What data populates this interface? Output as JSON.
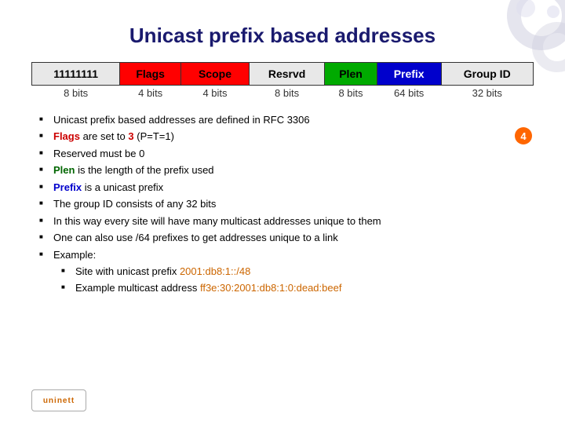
{
  "title": "Unicast prefix based addresses",
  "table": {
    "headers": [
      "11111111",
      "Flags",
      "Scope",
      "Resrvd",
      "Plen",
      "Prefix",
      "Group ID"
    ],
    "bits": [
      "8 bits",
      "4 bits",
      "4 bits",
      "8 bits",
      "8 bits",
      "64 bits",
      "32 bits"
    ]
  },
  "bullets": [
    {
      "text": "Unicast prefix based addresses are defined in RFC 3306",
      "highlights": []
    },
    {
      "text": "Flags are set to 3 (P=T=1)",
      "highlights": [
        {
          "word": "Flags",
          "color": "red"
        },
        {
          "word": "3",
          "color": "red"
        }
      ]
    },
    {
      "text": "Reserved must be 0",
      "highlights": []
    },
    {
      "text": "Plen is the length of the prefix used",
      "highlights": [
        {
          "word": "Plen",
          "color": "green"
        }
      ]
    },
    {
      "text": "Prefix is a unicast prefix",
      "highlights": [
        {
          "word": "Prefix",
          "color": "blue"
        }
      ]
    },
    {
      "text": "The group ID consists of any 32 bits",
      "highlights": []
    },
    {
      "text": "In this way every site will have many multicast addresses unique to them",
      "highlights": []
    },
    {
      "text": "One can also use /64 prefixes to get addresses unique to a link",
      "highlights": []
    },
    {
      "text": "Example:",
      "highlights": []
    }
  ],
  "subbullets": [
    {
      "text": "Site with unicast prefix ",
      "code": "2001:db8:1::/48"
    },
    {
      "text": "Example multicast address ",
      "code": "ff3e:30:2001:db8:1:0:dead:beef"
    }
  ],
  "badge": "4",
  "logo": "uninett"
}
